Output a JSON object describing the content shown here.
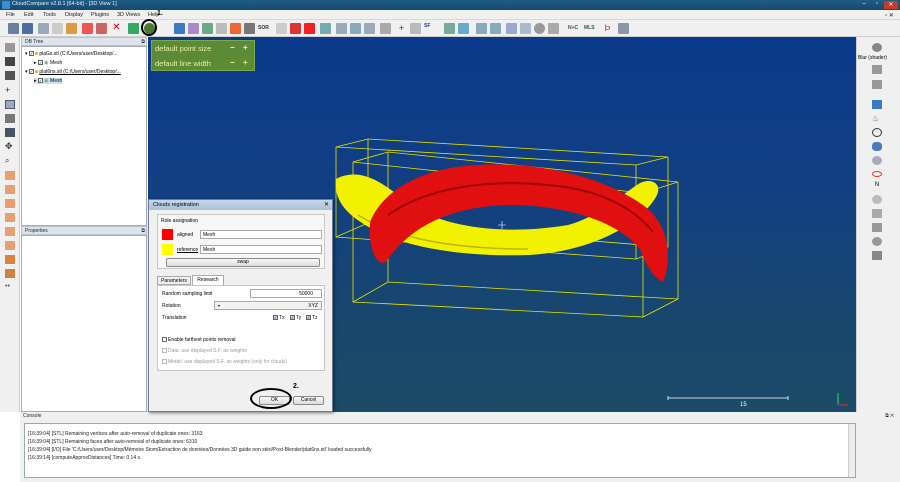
{
  "window": {
    "title": "CloudCompare v2.8.1 [64-bit] - [3D View 1]",
    "min": "–",
    "max": "▫",
    "close": "✕"
  },
  "menu": [
    "File",
    "Edit",
    "Tools",
    "Display",
    "Plugins",
    "3D Views",
    "Help"
  ],
  "toolbar": {
    "sf_label": "SF",
    "sor_label": "SOR",
    "nc_label": "N+C",
    "mls_label": "MLS"
  },
  "annotations": {
    "first": "1.",
    "second": "2."
  },
  "db_tree": {
    "header": "DB Tree",
    "items": [
      {
        "name": "plaGs.stl (C:/Users/user/Desktop/...",
        "child": "Mesh"
      },
      {
        "name": "plat6ns.stl (C:/Users/user/Desktop/...",
        "child": "Mesh"
      }
    ]
  },
  "properties": {
    "header": "Properties"
  },
  "gl_overlay": {
    "point_size": "default point size",
    "line_width": "default line width",
    "minus": "−",
    "plus": "+"
  },
  "scale_bar": {
    "value": "15"
  },
  "right_toolbar": {
    "blur_label": "Blur (shader)"
  },
  "dialog": {
    "title": "Clouds registration",
    "role_assignation": "Role assignation",
    "aligned_label": "aligned",
    "aligned_value": "Mesh",
    "reference_label": "reference",
    "reference_value": "Mesh",
    "swap": "swap",
    "tabs": [
      "Parameters",
      "Research"
    ],
    "random_sampling_label": "Random sampling limit",
    "random_sampling_value": "50000",
    "rotation_label": "Rotation",
    "rotation_value": "XYZ",
    "translation_label": "Translation",
    "tx": "Tx",
    "ty": "Ty",
    "tz": "Tz",
    "farthest": "Enable farthest points removal",
    "data_sf": "Data: use displayed S.F. as weights",
    "model_sf": "Model: use displayed S.F. as weights (only for clouds)",
    "ok": "OK",
    "cancel": "Cancel",
    "colors": {
      "aligned": "#ff0000",
      "reference": "#ffff00"
    }
  },
  "console": {
    "header": "Console",
    "lines": [
      "[16:39:04] [STL] Remaining vertices after auto-removal of duplicate ones: 3163",
      "[16:39:04] [STL] Remaining faces after auto-removal of duplicate ones: 6310",
      "[16:39:04] [I/O] File 'C:/Users/user/Desktop/Mémoire Stom/Extraction de données/Données 3D guide non stéri/Post-Blender/plat6ns.stl' loaded successfully",
      "[16:39:14] [computeApproxDistances] Time: 0.14 s."
    ]
  },
  "colors": {
    "viewport_top": "#0b3a8c",
    "viewport_bottom": "#1b4b66",
    "mesh_red": "#e01010",
    "mesh_yellow": "#f2f200",
    "bbox": "#e6e600",
    "gl_panel": "#5c8a36"
  }
}
